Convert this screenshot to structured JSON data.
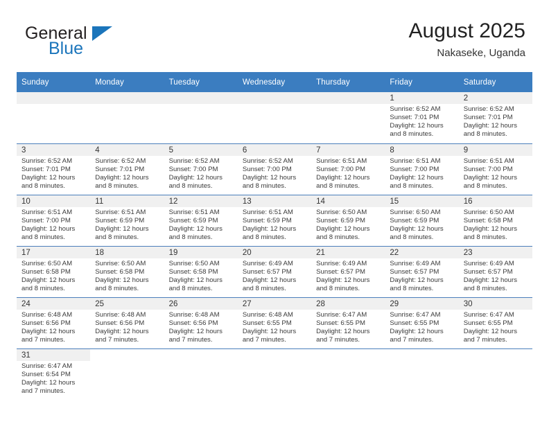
{
  "brand": {
    "line1": "General",
    "line2": "Blue",
    "accent_color": "#1b75bb"
  },
  "header": {
    "title": "August 2025",
    "subtitle": "Nakaseke, Uganda"
  },
  "calendar": {
    "header_color": "#3b7dc0",
    "weekday_headers": [
      "Sunday",
      "Monday",
      "Tuesday",
      "Wednesday",
      "Thursday",
      "Friday",
      "Saturday"
    ],
    "weeks": [
      [
        {
          "day": "",
          "sunrise": "",
          "sunset": "",
          "daylight_1": "",
          "daylight_2": ""
        },
        {
          "day": "",
          "sunrise": "",
          "sunset": "",
          "daylight_1": "",
          "daylight_2": ""
        },
        {
          "day": "",
          "sunrise": "",
          "sunset": "",
          "daylight_1": "",
          "daylight_2": ""
        },
        {
          "day": "",
          "sunrise": "",
          "sunset": "",
          "daylight_1": "",
          "daylight_2": ""
        },
        {
          "day": "",
          "sunrise": "",
          "sunset": "",
          "daylight_1": "",
          "daylight_2": ""
        },
        {
          "day": "1",
          "sunrise": "Sunrise: 6:52 AM",
          "sunset": "Sunset: 7:01 PM",
          "daylight_1": "Daylight: 12 hours",
          "daylight_2": "and 8 minutes."
        },
        {
          "day": "2",
          "sunrise": "Sunrise: 6:52 AM",
          "sunset": "Sunset: 7:01 PM",
          "daylight_1": "Daylight: 12 hours",
          "daylight_2": "and 8 minutes."
        }
      ],
      [
        {
          "day": "3",
          "sunrise": "Sunrise: 6:52 AM",
          "sunset": "Sunset: 7:01 PM",
          "daylight_1": "Daylight: 12 hours",
          "daylight_2": "and 8 minutes."
        },
        {
          "day": "4",
          "sunrise": "Sunrise: 6:52 AM",
          "sunset": "Sunset: 7:01 PM",
          "daylight_1": "Daylight: 12 hours",
          "daylight_2": "and 8 minutes."
        },
        {
          "day": "5",
          "sunrise": "Sunrise: 6:52 AM",
          "sunset": "Sunset: 7:00 PM",
          "daylight_1": "Daylight: 12 hours",
          "daylight_2": "and 8 minutes."
        },
        {
          "day": "6",
          "sunrise": "Sunrise: 6:52 AM",
          "sunset": "Sunset: 7:00 PM",
          "daylight_1": "Daylight: 12 hours",
          "daylight_2": "and 8 minutes."
        },
        {
          "day": "7",
          "sunrise": "Sunrise: 6:51 AM",
          "sunset": "Sunset: 7:00 PM",
          "daylight_1": "Daylight: 12 hours",
          "daylight_2": "and 8 minutes."
        },
        {
          "day": "8",
          "sunrise": "Sunrise: 6:51 AM",
          "sunset": "Sunset: 7:00 PM",
          "daylight_1": "Daylight: 12 hours",
          "daylight_2": "and 8 minutes."
        },
        {
          "day": "9",
          "sunrise": "Sunrise: 6:51 AM",
          "sunset": "Sunset: 7:00 PM",
          "daylight_1": "Daylight: 12 hours",
          "daylight_2": "and 8 minutes."
        }
      ],
      [
        {
          "day": "10",
          "sunrise": "Sunrise: 6:51 AM",
          "sunset": "Sunset: 7:00 PM",
          "daylight_1": "Daylight: 12 hours",
          "daylight_2": "and 8 minutes."
        },
        {
          "day": "11",
          "sunrise": "Sunrise: 6:51 AM",
          "sunset": "Sunset: 6:59 PM",
          "daylight_1": "Daylight: 12 hours",
          "daylight_2": "and 8 minutes."
        },
        {
          "day": "12",
          "sunrise": "Sunrise: 6:51 AM",
          "sunset": "Sunset: 6:59 PM",
          "daylight_1": "Daylight: 12 hours",
          "daylight_2": "and 8 minutes."
        },
        {
          "day": "13",
          "sunrise": "Sunrise: 6:51 AM",
          "sunset": "Sunset: 6:59 PM",
          "daylight_1": "Daylight: 12 hours",
          "daylight_2": "and 8 minutes."
        },
        {
          "day": "14",
          "sunrise": "Sunrise: 6:50 AM",
          "sunset": "Sunset: 6:59 PM",
          "daylight_1": "Daylight: 12 hours",
          "daylight_2": "and 8 minutes."
        },
        {
          "day": "15",
          "sunrise": "Sunrise: 6:50 AM",
          "sunset": "Sunset: 6:59 PM",
          "daylight_1": "Daylight: 12 hours",
          "daylight_2": "and 8 minutes."
        },
        {
          "day": "16",
          "sunrise": "Sunrise: 6:50 AM",
          "sunset": "Sunset: 6:58 PM",
          "daylight_1": "Daylight: 12 hours",
          "daylight_2": "and 8 minutes."
        }
      ],
      [
        {
          "day": "17",
          "sunrise": "Sunrise: 6:50 AM",
          "sunset": "Sunset: 6:58 PM",
          "daylight_1": "Daylight: 12 hours",
          "daylight_2": "and 8 minutes."
        },
        {
          "day": "18",
          "sunrise": "Sunrise: 6:50 AM",
          "sunset": "Sunset: 6:58 PM",
          "daylight_1": "Daylight: 12 hours",
          "daylight_2": "and 8 minutes."
        },
        {
          "day": "19",
          "sunrise": "Sunrise: 6:50 AM",
          "sunset": "Sunset: 6:58 PM",
          "daylight_1": "Daylight: 12 hours",
          "daylight_2": "and 8 minutes."
        },
        {
          "day": "20",
          "sunrise": "Sunrise: 6:49 AM",
          "sunset": "Sunset: 6:57 PM",
          "daylight_1": "Daylight: 12 hours",
          "daylight_2": "and 8 minutes."
        },
        {
          "day": "21",
          "sunrise": "Sunrise: 6:49 AM",
          "sunset": "Sunset: 6:57 PM",
          "daylight_1": "Daylight: 12 hours",
          "daylight_2": "and 8 minutes."
        },
        {
          "day": "22",
          "sunrise": "Sunrise: 6:49 AM",
          "sunset": "Sunset: 6:57 PM",
          "daylight_1": "Daylight: 12 hours",
          "daylight_2": "and 8 minutes."
        },
        {
          "day": "23",
          "sunrise": "Sunrise: 6:49 AM",
          "sunset": "Sunset: 6:57 PM",
          "daylight_1": "Daylight: 12 hours",
          "daylight_2": "and 8 minutes."
        }
      ],
      [
        {
          "day": "24",
          "sunrise": "Sunrise: 6:48 AM",
          "sunset": "Sunset: 6:56 PM",
          "daylight_1": "Daylight: 12 hours",
          "daylight_2": "and 7 minutes."
        },
        {
          "day": "25",
          "sunrise": "Sunrise: 6:48 AM",
          "sunset": "Sunset: 6:56 PM",
          "daylight_1": "Daylight: 12 hours",
          "daylight_2": "and 7 minutes."
        },
        {
          "day": "26",
          "sunrise": "Sunrise: 6:48 AM",
          "sunset": "Sunset: 6:56 PM",
          "daylight_1": "Daylight: 12 hours",
          "daylight_2": "and 7 minutes."
        },
        {
          "day": "27",
          "sunrise": "Sunrise: 6:48 AM",
          "sunset": "Sunset: 6:55 PM",
          "daylight_1": "Daylight: 12 hours",
          "daylight_2": "and 7 minutes."
        },
        {
          "day": "28",
          "sunrise": "Sunrise: 6:47 AM",
          "sunset": "Sunset: 6:55 PM",
          "daylight_1": "Daylight: 12 hours",
          "daylight_2": "and 7 minutes."
        },
        {
          "day": "29",
          "sunrise": "Sunrise: 6:47 AM",
          "sunset": "Sunset: 6:55 PM",
          "daylight_1": "Daylight: 12 hours",
          "daylight_2": "and 7 minutes."
        },
        {
          "day": "30",
          "sunrise": "Sunrise: 6:47 AM",
          "sunset": "Sunset: 6:55 PM",
          "daylight_1": "Daylight: 12 hours",
          "daylight_2": "and 7 minutes."
        }
      ],
      [
        {
          "day": "31",
          "sunrise": "Sunrise: 6:47 AM",
          "sunset": "Sunset: 6:54 PM",
          "daylight_1": "Daylight: 12 hours",
          "daylight_2": "and 7 minutes."
        },
        {
          "day": "",
          "sunrise": "",
          "sunset": "",
          "daylight_1": "",
          "daylight_2": ""
        },
        {
          "day": "",
          "sunrise": "",
          "sunset": "",
          "daylight_1": "",
          "daylight_2": ""
        },
        {
          "day": "",
          "sunrise": "",
          "sunset": "",
          "daylight_1": "",
          "daylight_2": ""
        },
        {
          "day": "",
          "sunrise": "",
          "sunset": "",
          "daylight_1": "",
          "daylight_2": ""
        },
        {
          "day": "",
          "sunrise": "",
          "sunset": "",
          "daylight_1": "",
          "daylight_2": ""
        },
        {
          "day": "",
          "sunrise": "",
          "sunset": "",
          "daylight_1": "",
          "daylight_2": ""
        }
      ]
    ]
  }
}
